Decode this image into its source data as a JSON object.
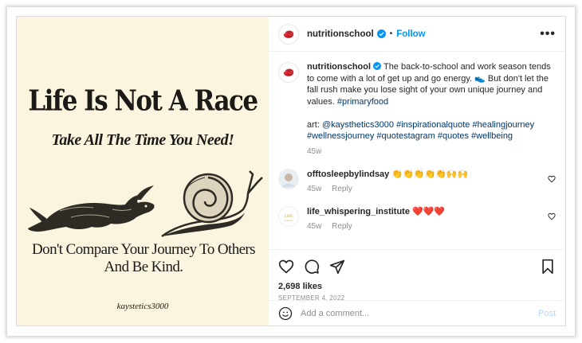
{
  "image": {
    "title": "Life Is Not A Race",
    "subtitle": "Take All The Time You Need!",
    "footer": "Don't Compare Your Journey To Others And Be Kind.",
    "signature": "kaystetics3000"
  },
  "header": {
    "username": "nutritionschool",
    "separator": "•",
    "follow_label": "Follow",
    "more_icon": "more-horizontal-icon"
  },
  "caption": {
    "username": "nutritionschool",
    "text1": "The back-to-school and work season tends to come with a lot of get up and go energy.",
    "emoji1": "👟",
    "text2": "But don't let the fall rush make you lose sight of your own unique journey and values.",
    "hashtag1": "#primaryfood",
    "art_prefix": "art:",
    "art_handle": "@kaysthetics3000",
    "hashtags": "#inspirationalquote #healingjourney #wellnessjourney #quotestagram #quotes #wellbeing",
    "time": "45w"
  },
  "comments": [
    {
      "username": "offtosleepbylindsay",
      "text": "👏👏👏👏👏🙌🙌",
      "time": "45w",
      "reply": "Reply"
    },
    {
      "username": "life_whispering_institute",
      "text": "❤️❤️❤️",
      "time": "45w",
      "reply": "Reply"
    }
  ],
  "stats": {
    "likes": "2,698 likes",
    "date": "SEPTEMBER 4, 2022"
  },
  "add_comment": {
    "placeholder": "Add a comment...",
    "post_label": "Post"
  },
  "colors": {
    "accent": "#0095f6",
    "brand_red": "#c8202a",
    "poster_bg": "#fbf4de"
  }
}
